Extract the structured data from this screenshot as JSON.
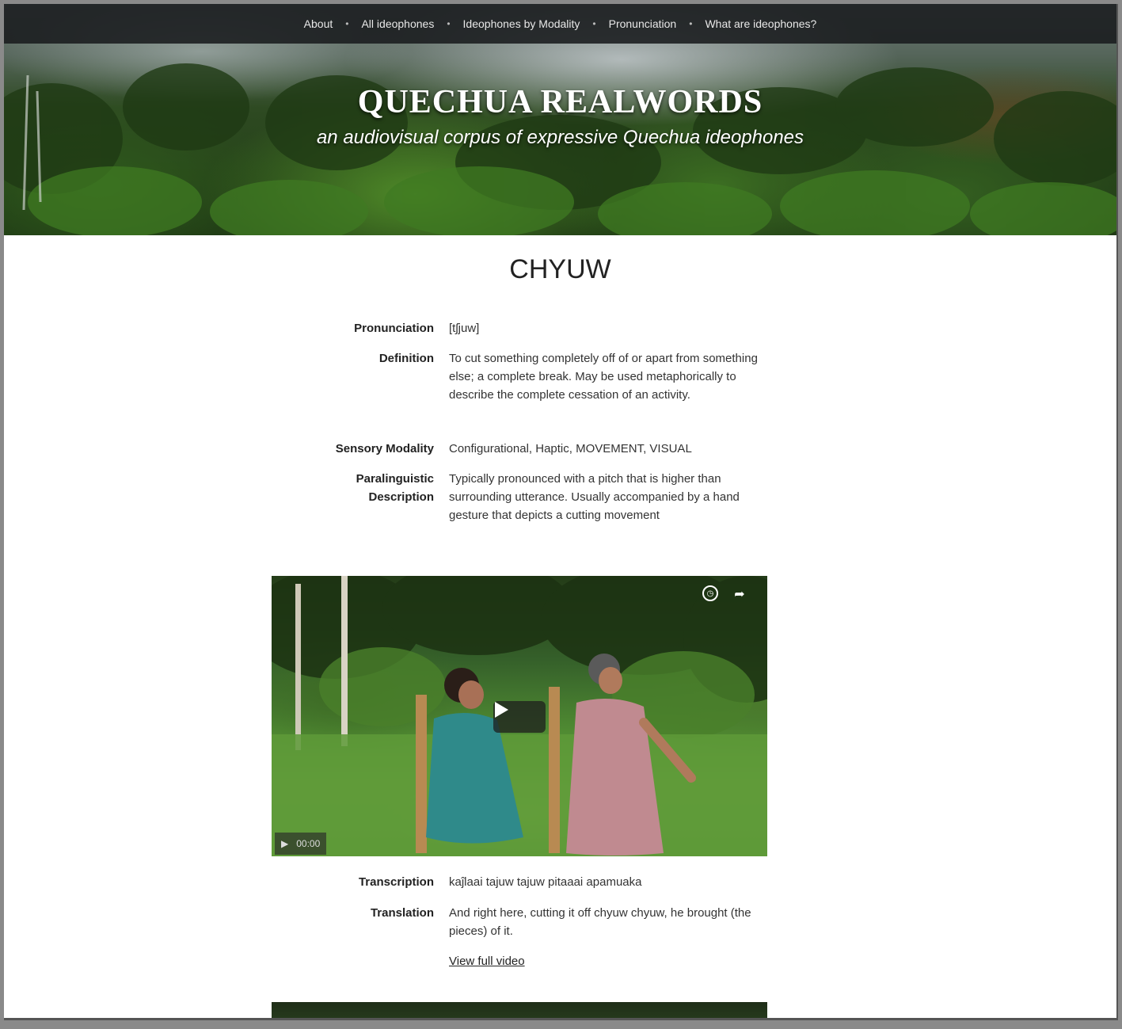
{
  "nav": {
    "items": [
      "About",
      "All ideophones",
      "Ideophones by Modality",
      "Pronunciation",
      "What are ideophones?"
    ],
    "separator": "•"
  },
  "header": {
    "title": "QUECHUA REALWORDS",
    "subtitle": "an audiovisual corpus of expressive Quechua ideophones"
  },
  "entry": {
    "word": "CHYUW",
    "pronunciation_label": "Pronunciation",
    "pronunciation": "[tʃjuw]",
    "definition_label": "Definition",
    "definition_lines": [
      "To cut something completely off of or apart from something",
      "else; a complete break. May be used metaphorically to",
      "describe the complete cessation of an activity."
    ],
    "modality_label": "Sensory Modality",
    "modality": "Configurational, Haptic, MOVEMENT, VISUAL",
    "paralinguistic_label_1": "Paralinguistic",
    "paralinguistic_label_2": "Description",
    "paralinguistic_lines": [
      "Typically pronounced with a pitch that is higher than",
      "surrounding utterance. Usually accompanied by a hand",
      "gesture that depicts a cutting movement"
    ]
  },
  "video": {
    "timestamp": "00:00",
    "transcription_label": "Transcription",
    "transcription": "kaĵlaai tajuw tajuw pitaaai apamuaka",
    "translation_label": "Translation",
    "translation_lines": [
      "And right here, cutting it off chyuw chyuw, he brought (the",
      "pieces) of it."
    ],
    "view_link": "View full video"
  },
  "colors": {
    "navbar": "#1c1e21",
    "accent_text": "#222222"
  }
}
